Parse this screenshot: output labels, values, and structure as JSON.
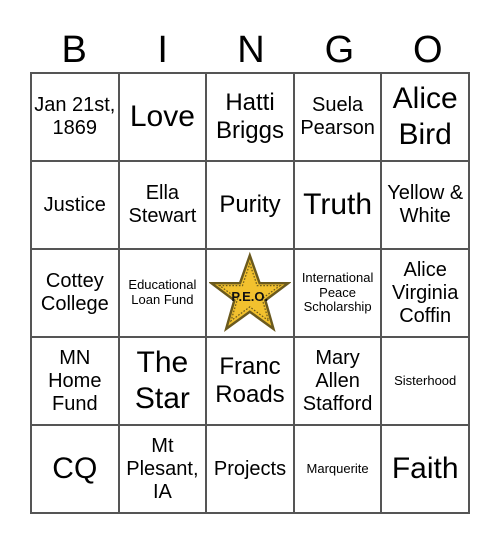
{
  "header": {
    "letters": [
      "B",
      "I",
      "N",
      "G",
      "O"
    ]
  },
  "cells": [
    {
      "text": "Jan 21st, 1869",
      "size": "s20"
    },
    {
      "text": "Love",
      "size": "s30"
    },
    {
      "text": "Hatti Briggs",
      "size": "s24"
    },
    {
      "text": "Suela Pearson",
      "size": "s20"
    },
    {
      "text": "Alice Bird",
      "size": "s30"
    },
    {
      "text": "Justice",
      "size": "s20"
    },
    {
      "text": "Ella Stewart",
      "size": "s20"
    },
    {
      "text": "Purity",
      "size": "s24"
    },
    {
      "text": "Truth",
      "size": "s30"
    },
    {
      "text": "Yellow & White",
      "size": "s20"
    },
    {
      "text": "Cottey College",
      "size": "s20"
    },
    {
      "text": "Educational Loan Fund",
      "size": "s12"
    },
    {
      "text": "P.E.O.",
      "size": "star",
      "free": true
    },
    {
      "text": "International Peace Scholarship",
      "size": "s12"
    },
    {
      "text": "Alice Virginia Coffin",
      "size": "s20"
    },
    {
      "text": "MN Home Fund",
      "size": "s20"
    },
    {
      "text": "The Star",
      "size": "s30"
    },
    {
      "text": "Franc Roads",
      "size": "s24"
    },
    {
      "text": "Mary Allen Stafford",
      "size": "s20"
    },
    {
      "text": "Sisterhood",
      "size": "s12"
    },
    {
      "text": "CQ",
      "size": "s30"
    },
    {
      "text": "Mt Plesant, IA",
      "size": "s20"
    },
    {
      "text": "Projects",
      "size": "s20"
    },
    {
      "text": "Marquerite",
      "size": "s12"
    },
    {
      "text": "Faith",
      "size": "s30"
    }
  ],
  "colors": {
    "star_fill": "#f2c12e",
    "star_border": "#6b5a1e",
    "grid_line": "#555555"
  }
}
